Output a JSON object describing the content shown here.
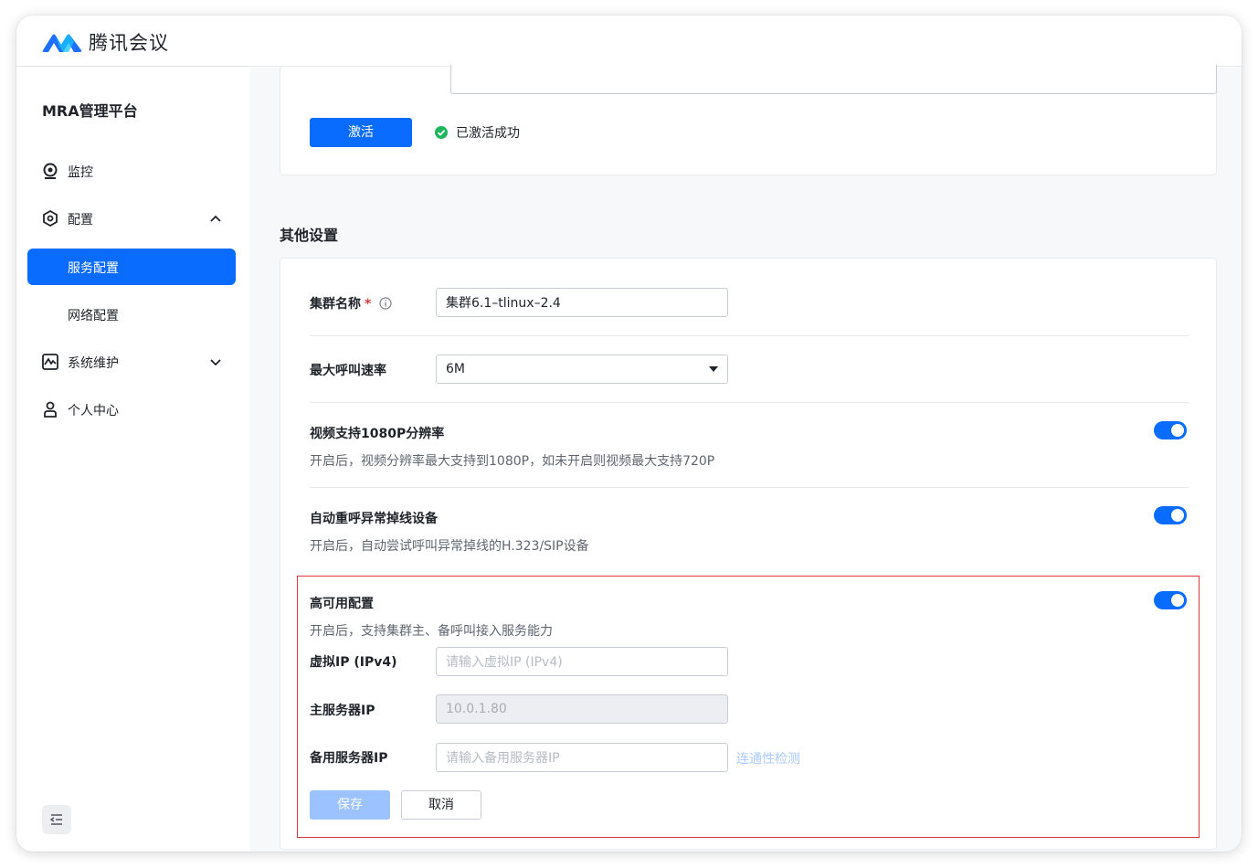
{
  "app": {
    "title": "腾讯会议",
    "logo_icon": "tencent-meeting-logo"
  },
  "sidebar": {
    "platform_title": "MRA管理平台",
    "items": [
      {
        "label": "监控",
        "icon": "monitor-icon"
      },
      {
        "label": "配置",
        "icon": "settings-icon",
        "expanded": true
      },
      {
        "label": "服务配置",
        "active": true
      },
      {
        "label": "网络配置"
      },
      {
        "label": "系统维护",
        "icon": "system-maintenance-icon",
        "expanded": false
      },
      {
        "label": "个人中心",
        "icon": "user-icon"
      }
    ],
    "collapse_icon": "collapse-sidebar-icon"
  },
  "activation": {
    "button_label": "激活",
    "status_text": "已激活成功",
    "status_color": "#1fb55f"
  },
  "other_settings": {
    "section_title": "其他设置",
    "cluster_name": {
      "label": "集群名称",
      "required_mark": "*",
      "value": "集群6.1–tlinux–2.4"
    },
    "max_call_rate": {
      "label": "最大呼叫速率",
      "selected": "6M"
    },
    "video_1080p": {
      "label": "视频支持1080P分辨率",
      "description": "开启后，视频分辨率最大支持到1080P，如未开启则视频最大支持720P",
      "enabled": true
    },
    "auto_redial": {
      "label": "自动重呼异常掉线设备",
      "description": "开启后，自动尝试呼叫异常掉线的H.323/SIP设备",
      "enabled": true
    },
    "high_availability": {
      "label": "高可用配置",
      "description": "开启后，支持集群主、备呼叫接入服务能力",
      "enabled": true,
      "virtual_ip": {
        "label": "虚拟IP (IPv4)",
        "placeholder": "请输入虚拟IP (IPv4)"
      },
      "primary_ip": {
        "label": "主服务器IP",
        "value": "10.0.1.80"
      },
      "backup_ip": {
        "label": "备用服务器IP",
        "placeholder": "请输入备用服务器IP"
      },
      "connectivity_check": "连通性检测"
    },
    "save_label": "保存",
    "cancel_label": "取消"
  },
  "colors": {
    "accent": "#0a6cff",
    "highlight_border": "#e0393e"
  }
}
